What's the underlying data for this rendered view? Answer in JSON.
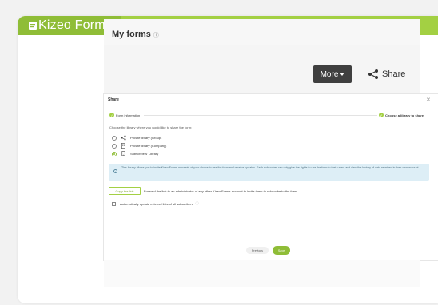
{
  "brand": {
    "logo_text": "Kizeo Forms",
    "color_primary": "#a3d043",
    "color_dark": "#8fbd37"
  },
  "header": {
    "page_title": "My forms",
    "title_info_icon": "info-icon"
  },
  "actions": {
    "more_label": "More",
    "share_label": "Share"
  },
  "modal": {
    "title": "Share",
    "close_icon": "close-icon",
    "steps": [
      {
        "label": "Form information",
        "state": "done"
      },
      {
        "label": "Choose a library to share",
        "state": "active"
      }
    ],
    "choose_text": "Choose the library where you would like to share the form:",
    "options": [
      {
        "label": "Private library (Group)",
        "icon": "share-icon",
        "selected": false
      },
      {
        "label": "Private library (Company)",
        "icon": "building-icon",
        "selected": false
      },
      {
        "label": "Subscribers' Library",
        "icon": "bookmark-icon",
        "selected": true
      }
    ],
    "info_text": "This library allows you to invite Kizeo Forms accounts of your choice to use the form and receive updates. Each subscriber can only give the rights to use the form to their users and view the history of data received in their own account.",
    "copy_link_label": "Copy the link",
    "copy_link_desc": "Forward the link to an administrator of any other Kizeo Forms account to invite them to subscribe to the form",
    "auto_update_label": "Automatically update external lists of all subscribers",
    "auto_update_checked": false,
    "previous_label": "Previous",
    "save_label": "Save"
  }
}
